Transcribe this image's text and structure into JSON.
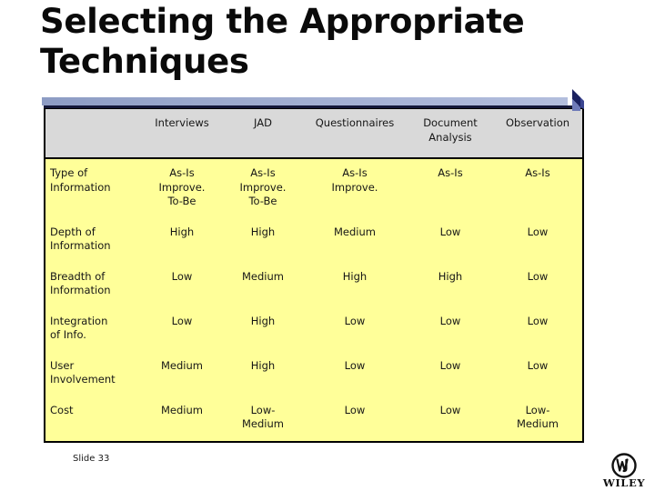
{
  "slide": {
    "title": "Selecting the Appropriate Techniques",
    "slide_number": "Slide 33",
    "logo_text": "WILEY",
    "colors": {
      "strip_dark": "#2b4f8e",
      "strip_light": "#f4f5f9",
      "bar": "#9aa8cc",
      "arrow": "#1b2260",
      "table_header_bg": "#d9d9d9",
      "table_body_bg": "#ffff99",
      "table_border": "#000000",
      "title_text": "#0a0a0a"
    }
  },
  "table": {
    "columns": [
      "",
      "Interviews",
      "JAD",
      "Questionnaires",
      "Document\nAnalysis",
      "Observation"
    ],
    "rows": [
      {
        "label": "Type of\nInformation",
        "values": [
          "As-Is\nImprove.\nTo-Be",
          "As-Is\nImprove.\nTo-Be",
          "As-Is\nImprove.",
          "As-Is",
          "As-Is"
        ]
      },
      {
        "label": "Depth of\nInformation",
        "values": [
          "High",
          "High",
          "Medium",
          "Low",
          "Low"
        ]
      },
      {
        "label": "Breadth of\nInformation",
        "values": [
          "Low",
          "Medium",
          "High",
          "High",
          "Low"
        ]
      },
      {
        "label": "Integration\nof Info.",
        "values": [
          "Low",
          "High",
          "Low",
          "Low",
          "Low"
        ]
      },
      {
        "label": "User\nInvolvement",
        "values": [
          "Medium",
          "High",
          "Low",
          "Low",
          "Low"
        ]
      },
      {
        "label": "Cost",
        "values": [
          "Medium",
          "Low-\nMedium",
          "Low",
          "Low",
          "Low-\nMedium"
        ]
      }
    ]
  }
}
